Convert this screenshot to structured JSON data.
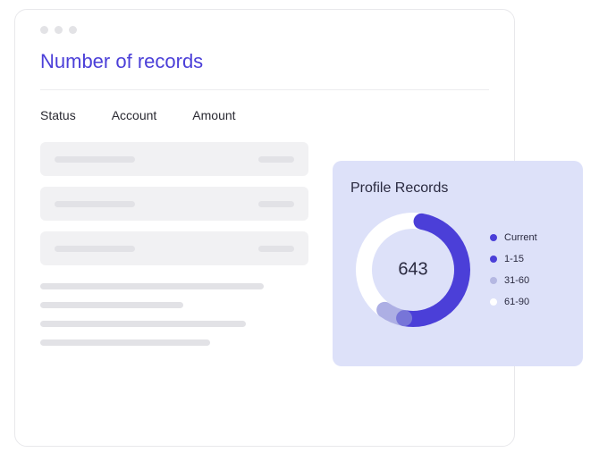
{
  "page": {
    "title": "Number of records"
  },
  "table": {
    "headers": [
      "Status",
      "Account",
      "Amount"
    ]
  },
  "profile": {
    "title": "Profile Records",
    "center_value": "643",
    "legend": [
      {
        "label": "Current",
        "color": "#4b3fd8"
      },
      {
        "label": "1-15",
        "color": "#4b3fd8"
      },
      {
        "label": "31-60",
        "color": "#b5b8e2"
      },
      {
        "label": "61-90",
        "color": "#ffffff"
      }
    ]
  },
  "chart_data": {
    "type": "pie",
    "title": "Profile Records",
    "center_label": "643",
    "series": [
      {
        "name": "Current",
        "value": 50,
        "color": "#4b3fd8"
      },
      {
        "name": "1-15",
        "value": 8,
        "color": "#7a7ed6"
      },
      {
        "name": "31-60",
        "value": 2,
        "color": "#b5b8e2"
      },
      {
        "name": "61-90",
        "value": 40,
        "color": "#ffffff"
      }
    ]
  }
}
